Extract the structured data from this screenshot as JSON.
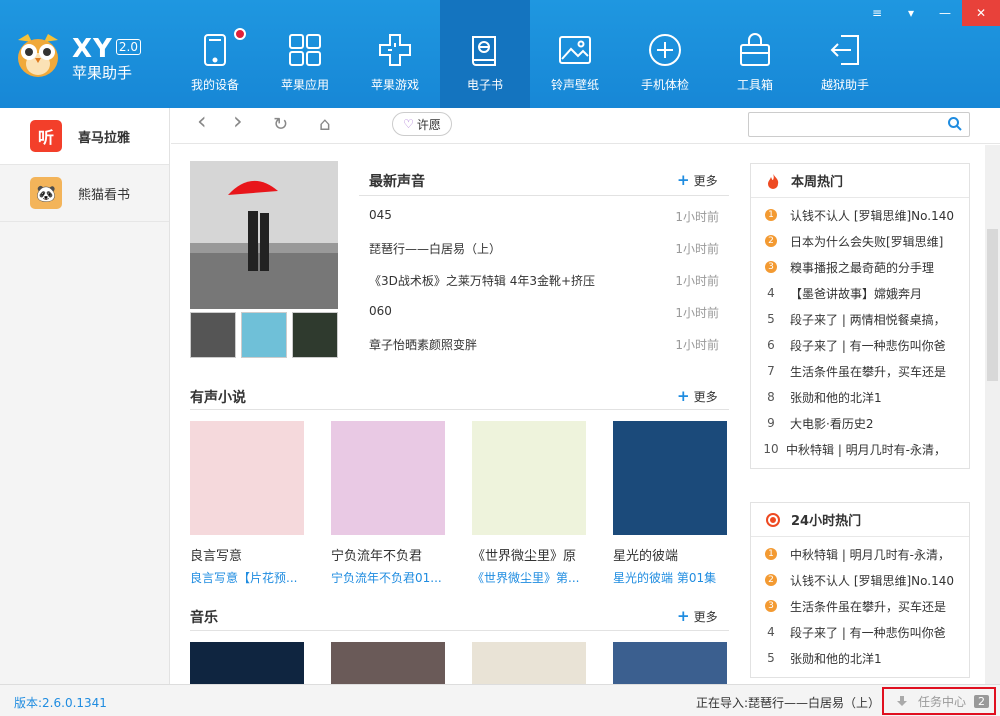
{
  "app": {
    "name": "XY",
    "version_badge": "2.0",
    "subtitle": "苹果助手"
  },
  "nav": [
    {
      "label": "我的设备",
      "icon": "tablet-icon"
    },
    {
      "label": "苹果应用",
      "icon": "apps-grid-icon"
    },
    {
      "label": "苹果游戏",
      "icon": "gamepad-icon"
    },
    {
      "label": "电子书",
      "icon": "ebook-icon"
    },
    {
      "label": "铃声壁纸",
      "icon": "wallpaper-icon"
    },
    {
      "label": "手机体检",
      "icon": "plus-check-icon"
    },
    {
      "label": "工具箱",
      "icon": "toolbox-icon"
    },
    {
      "label": "越狱助手",
      "icon": "jailbreak-icon"
    }
  ],
  "window_controls": [
    "≡",
    "▾",
    "—",
    "✕"
  ],
  "sidebar": [
    {
      "label": "喜马拉雅",
      "icon_text": "听",
      "color": "#f33f2a"
    },
    {
      "label": "熊猫看书",
      "icon_text": "🐼",
      "color": "#f3b45a"
    }
  ],
  "toolbar": {
    "back": "‹",
    "forward": "›",
    "refresh": "↻",
    "home": "⌂",
    "wish_label": "许愿",
    "wish_heart": "♡"
  },
  "latest": {
    "title": "最新声音",
    "more": "更多",
    "plus": "+",
    "items": [
      {
        "title": "045",
        "time": "1小时前"
      },
      {
        "title": "琵琶行——白居易（上）",
        "time": "1小时前"
      },
      {
        "title": "《3D战术板》之莱万特辑 4年3金靴+挤压",
        "time": "1小时前"
      },
      {
        "title": "060",
        "time": "1小时前"
      },
      {
        "title": "章子怡晒素颜照变胖",
        "time": "1小时前"
      }
    ]
  },
  "novels": {
    "title": "有声小说",
    "more": "更多",
    "plus": "+",
    "items": [
      {
        "name": "良言写意",
        "desc": "良言写意【片花预...",
        "color": "#f5d9dc"
      },
      {
        "name": "宁负流年不负君",
        "desc": "宁负流年不负君01...",
        "color": "#e9c9e4"
      },
      {
        "name": "《世界微尘里》原",
        "desc": "《世界微尘里》第...",
        "color": "#eef3dc"
      },
      {
        "name": "星光的彼端",
        "desc": "星光的彼端 第01集",
        "color": "#1b4a7a"
      }
    ]
  },
  "music": {
    "title": "音乐",
    "more": "更多",
    "plus": "+"
  },
  "week_hot": {
    "title": "本周热门",
    "items": [
      {
        "rank": "1",
        "text": "认钱不认人 [罗辑思维]No.140"
      },
      {
        "rank": "2",
        "text": "日本为什么会失败[罗辑思维]"
      },
      {
        "rank": "3",
        "text": "糗事播报之最奇葩的分手理"
      },
      {
        "rank": "4",
        "text": "【墨爸讲故事】嫦娥奔月"
      },
      {
        "rank": "5",
        "text": "段子来了 | 两情相悦餐桌搞，"
      },
      {
        "rank": "6",
        "text": "段子来了 | 有一种悲伤叫你爸"
      },
      {
        "rank": "7",
        "text": "生活条件虽在攀升，买车还是"
      },
      {
        "rank": "8",
        "text": "张勋和他的北洋1"
      },
      {
        "rank": "9",
        "text": "大电影·看历史2"
      },
      {
        "rank": "10",
        "text": "中秋特辑 | 明月几时有-永清，"
      }
    ]
  },
  "day_hot": {
    "title": "24小时热门",
    "items": [
      {
        "rank": "1",
        "text": "中秋特辑 | 明月几时有-永清，"
      },
      {
        "rank": "2",
        "text": "认钱不认人 [罗辑思维]No.140"
      },
      {
        "rank": "3",
        "text": "生活条件虽在攀升，买车还是"
      },
      {
        "rank": "4",
        "text": "段子来了 | 有一种悲伤叫你爸"
      },
      {
        "rank": "5",
        "text": "张勋和他的北洋1"
      }
    ]
  },
  "status": {
    "version": "版本:2.6.0.1341",
    "importing": "正在导入:琵琶行——白居易（上）",
    "task_center": "任务中心",
    "task_count": "2"
  }
}
